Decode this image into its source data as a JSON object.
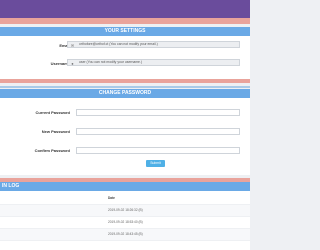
{
  "settings": {
    "title": "YOUR SETTINGS",
    "email_label": "Email",
    "email_value": "orthofore@orthof.ct (You can not modify your email.)",
    "username_label": "Username",
    "username_value": "user (You can not modify your username.)"
  },
  "password": {
    "title": "CHANGE PASSWORD",
    "current_label": "Current Password",
    "new_label": "New Password",
    "confirm_label": "Confirm Password",
    "submit_label": "Submit"
  },
  "login_log": {
    "title": "IN LOG",
    "column_header": "Date",
    "rows": [
      "2019-09-02 18:26:32 (B)",
      "2019-09-02 18:53:40 (B)",
      "2019-09-02 18:43:45 (B)"
    ]
  },
  "colors": {
    "header_purple": "#6a4c9c",
    "accent_salmon": "#e9a39b",
    "section_blue": "#6aa9e6",
    "button_blue": "#4fb0e6"
  },
  "icons": {
    "email_field": "envelope-icon",
    "username_field": "user-icon"
  }
}
